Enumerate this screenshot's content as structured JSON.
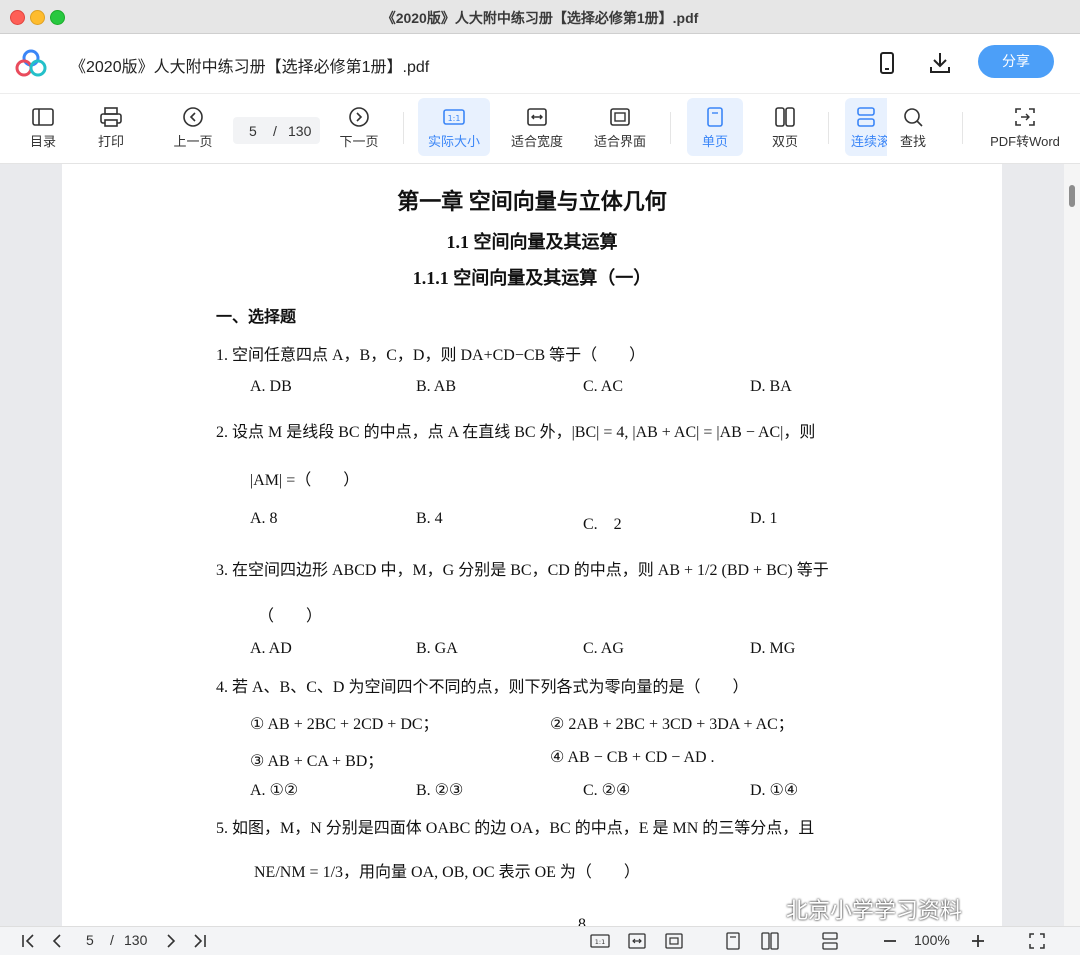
{
  "window": {
    "title": "《2020版》人大附中练习册【选择必修第1册】.pdf"
  },
  "header": {
    "doc_title": "《2020版》人大附中练习册【选择必修第1册】.pdf",
    "share_label": "分享"
  },
  "toolbar": {
    "items": [
      {
        "label": "目录",
        "icon": "sidebar-icon"
      },
      {
        "label": "打印",
        "icon": "printer-icon"
      },
      {
        "label": "上一页",
        "icon": "chevron-left-circle-icon"
      },
      {
        "label": "下一页",
        "icon": "chevron-right-circle-icon"
      },
      {
        "label": "实际大小",
        "icon": "actual-size-icon"
      },
      {
        "label": "适合宽度",
        "icon": "fit-width-icon"
      },
      {
        "label": "适合界面",
        "icon": "fit-page-icon"
      },
      {
        "label": "单页",
        "icon": "single-page-icon"
      },
      {
        "label": "双页",
        "icon": "double-page-icon"
      },
      {
        "label": "连续滚",
        "icon": "continuous-scroll-icon"
      },
      {
        "label": "查找",
        "icon": "search-icon"
      },
      {
        "label": "PDF转Word",
        "icon": "convert-icon"
      }
    ],
    "page_current": "5",
    "page_sep": "/",
    "page_total": "130"
  },
  "document": {
    "chapter": "第一章 空间向量与立体几何",
    "section": "1.1 空间向量及其运算",
    "subsection": "1.1.1 空间向量及其运算（一）",
    "part": "一、选择题",
    "q1": {
      "stem": "1. 空间任意四点 A，B，C，D，则 DA+CD−CB 等于（　　）",
      "a": "A. DB",
      "b": "B. AB",
      "c": "C. AC",
      "d": "D. BA"
    },
    "q2": {
      "stem": "2. 设点 M 是线段 BC 的中点，点 A 在直线 BC 外，|BC| = 4, |AB + AC| = |AB − AC|，则",
      "stem2": "|AM| =（　　）",
      "a": "A. 8",
      "b": "B. 4",
      "c": "C.　2",
      "d": "D. 1"
    },
    "q3": {
      "stem": "3. 在空间四边形 ABCD 中，M，G 分别是 BC，CD 的中点，则 AB + 1/2 (BD + BC) 等于",
      "stem2": "（　　）",
      "a": "A. AD",
      "b": "B. GA",
      "c": "C. AG",
      "d": "D. MG"
    },
    "q4": {
      "stem": "4. 若 A、B、C、D 为空间四个不同的点，则下列各式为零向量的是（　　）",
      "e1": "① AB + 2BC + 2CD + DC；",
      "e2": "② 2AB + 2BC + 3CD + 3DA + AC；",
      "e3": "③ AB + CA + BD；",
      "e4": "④ AB − CB + CD − AD .",
      "a": "A. ①②",
      "b": "B. ②③",
      "c": "C. ②④",
      "d": "D. ①④"
    },
    "q5": {
      "stem": "5. 如图，M，N 分别是四面体 OABC 的边 OA，BC 的中点，E 是 MN 的三等分点，且",
      "stem2": "NE/NM = 1/3，用向量 OA, OB, OC 表示 OE 为（　　）"
    },
    "page_number": "8"
  },
  "watermark": "北京小学学习资料",
  "statusbar": {
    "page_current": "5",
    "page_sep": "/",
    "page_total": "130",
    "zoom": "100%"
  }
}
